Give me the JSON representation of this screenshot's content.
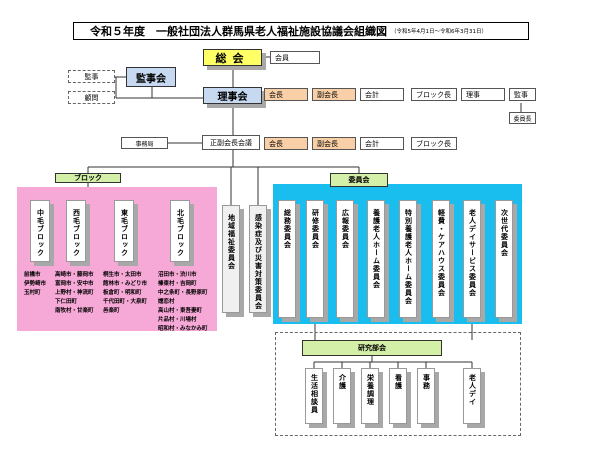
{
  "title": "令和５年度　一般社団法人群馬県老人福祉施設協議会組織図",
  "period": "（令和5年4月1日～令和6年3月31日）",
  "top": {
    "general_meeting": "総会",
    "members": "会員",
    "auditors_group": "監事会",
    "auditor": "監事",
    "advisor": "顧問",
    "board": "理事会",
    "board_roles": [
      "会長",
      "副会長",
      "会計",
      "ブロック長",
      "理事",
      "監事"
    ],
    "committee_chair": "委員長",
    "office": "事務局",
    "vice_meeting": "正副会長会議",
    "vice_roles": [
      "会長",
      "副会長",
      "会計",
      "ブロック長"
    ]
  },
  "blocks": {
    "label": "ブロック",
    "items": [
      {
        "name": "中毛ブロック",
        "members": [
          "前橋市",
          "伊勢崎市",
          "玉村町"
        ]
      },
      {
        "name": "西毛ブロック",
        "members": [
          "高崎市・藤岡市",
          "富岡市・安中市",
          "上野村・神流町",
          "下仁田町",
          "南牧村・甘楽町"
        ]
      },
      {
        "name": "東毛ブロック",
        "members": [
          "桐生市・太田市",
          "館林市・みどり市",
          "板倉町・明和町",
          "千代田町・大泉町",
          "邑楽町"
        ]
      },
      {
        "name": "北毛ブロック",
        "members": [
          "沼田市・渋川市",
          "榛東村・吉岡町",
          "中之条町・長野原町",
          "嬬恋村",
          "高山村・東吾妻町",
          "片品村・川場村",
          "昭和村・みなかみ町"
        ]
      }
    ]
  },
  "independent": [
    "地域福祉委員会",
    "感染症及び災害対策委員会"
  ],
  "committees": {
    "label": "委員会",
    "items": [
      "総務委員会",
      "研修委員会",
      "広報委員会",
      "養護老人ホーム委員会",
      "特別養護老人ホーム委員会",
      "軽費・ケアハウス委員会",
      "老人デイサービス委員会",
      "次世代委員会"
    ]
  },
  "research": {
    "label": "研究部会",
    "items": [
      "生活相談員",
      "介護",
      "栄養調理",
      "看護",
      "事務",
      "老人デイ"
    ]
  },
  "colors": {
    "pink": "#f6a8d6",
    "cyan": "#19bdee",
    "green": "#d4efa8",
    "yellow": "#ffff66",
    "lightblue": "#c6d9f0",
    "orange": "#f8cfa6"
  }
}
